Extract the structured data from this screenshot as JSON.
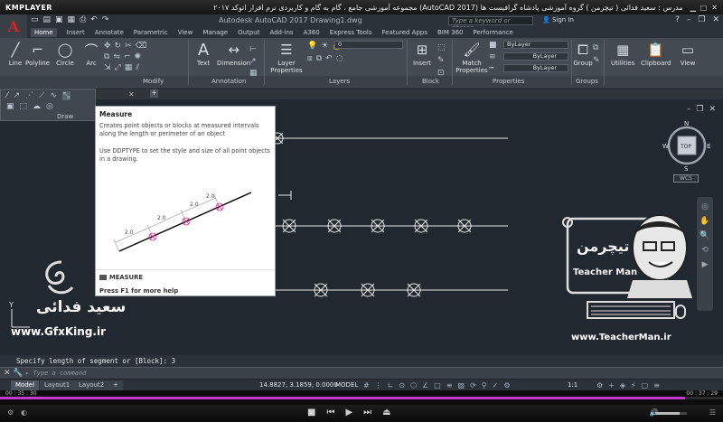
{
  "kmplayer": {
    "logo": "KMPLAYER",
    "title": "مجموعه آموزشی جامع ، گام به گام و کاربردی نرم افزار اتوکد ۲۰۱۷ (AutoCAD 2017) مدرس : سعید فدائی ( تیچرمن ) گروه آموزشی پادشاه گرافیست ها",
    "time_current": "00 : 35 : 30",
    "time_total": "00 : 37 : 29",
    "progress": 0.947,
    "volume": 0.8
  },
  "autocad": {
    "logo": "A",
    "app_title": "Autodesk AutoCAD 2017    Drawing1.dwg",
    "search_placeholder": "Type a keyword or phrase",
    "sign_in": "Sign In",
    "tabs": [
      "Home",
      "Insert",
      "Annotate",
      "Parametric",
      "View",
      "Manage",
      "Output",
      "Add-ins",
      "A360",
      "Express Tools",
      "Featured Apps",
      "BIM 360",
      "Performance"
    ],
    "active_tab": "Home",
    "ribbon": {
      "line": "Line",
      "polyline": "Polyline",
      "circle": "Circle",
      "arc": "Arc",
      "text": "Text",
      "dimension": "Dimension",
      "layer_properties": "Layer\nProperties",
      "insert": "Insert",
      "match_properties": "Match\nProperties",
      "group": "Group",
      "utilities": "Utilities",
      "clipboard": "Clipboard",
      "view": "View",
      "bylayer1": "ByLayer",
      "bylayer2": "ByLayer",
      "bylayer3": "ByLayer",
      "layer_value": "0",
      "panels": {
        "modify": "Modify",
        "annotation": "Annotation",
        "layers": "Layers",
        "block": "Block",
        "properties": "Properties",
        "groups": "Groups",
        "draw": "Draw"
      }
    },
    "tooltip": {
      "title": "Measure",
      "description": "Creates point objects or blocks at measured intervals along the length or perimeter of an object",
      "description2": "Use DDPTYPE to set the style and size of all point objects in a drawing.",
      "command": "MEASURE",
      "help": "Press F1 for more help",
      "dims": [
        "2.0",
        "2.0",
        "2.0",
        "2.0"
      ]
    },
    "viewcube": {
      "top": "TOP",
      "n": "N",
      "s": "S",
      "e": "E",
      "w": "W",
      "wcs": "WCS"
    },
    "command_history": "Specify length of segment or [Block]: 3",
    "command_placeholder": "Type a command",
    "layout_tabs": [
      "Model",
      "Layout1",
      "Layout2"
    ],
    "active_layout": "Model",
    "coordinates": "14.8827, 3.1859, 0.0000",
    "model_button": "MODEL",
    "scale": "1:1"
  },
  "watermarks": {
    "name": "سعید فدائی",
    "site_left": "www.GfxKing.ir",
    "site_right": "www.TeacherMan.ir",
    "teacherman_fa": "تیچرمن",
    "teacherman_en": "Teacher Man"
  }
}
